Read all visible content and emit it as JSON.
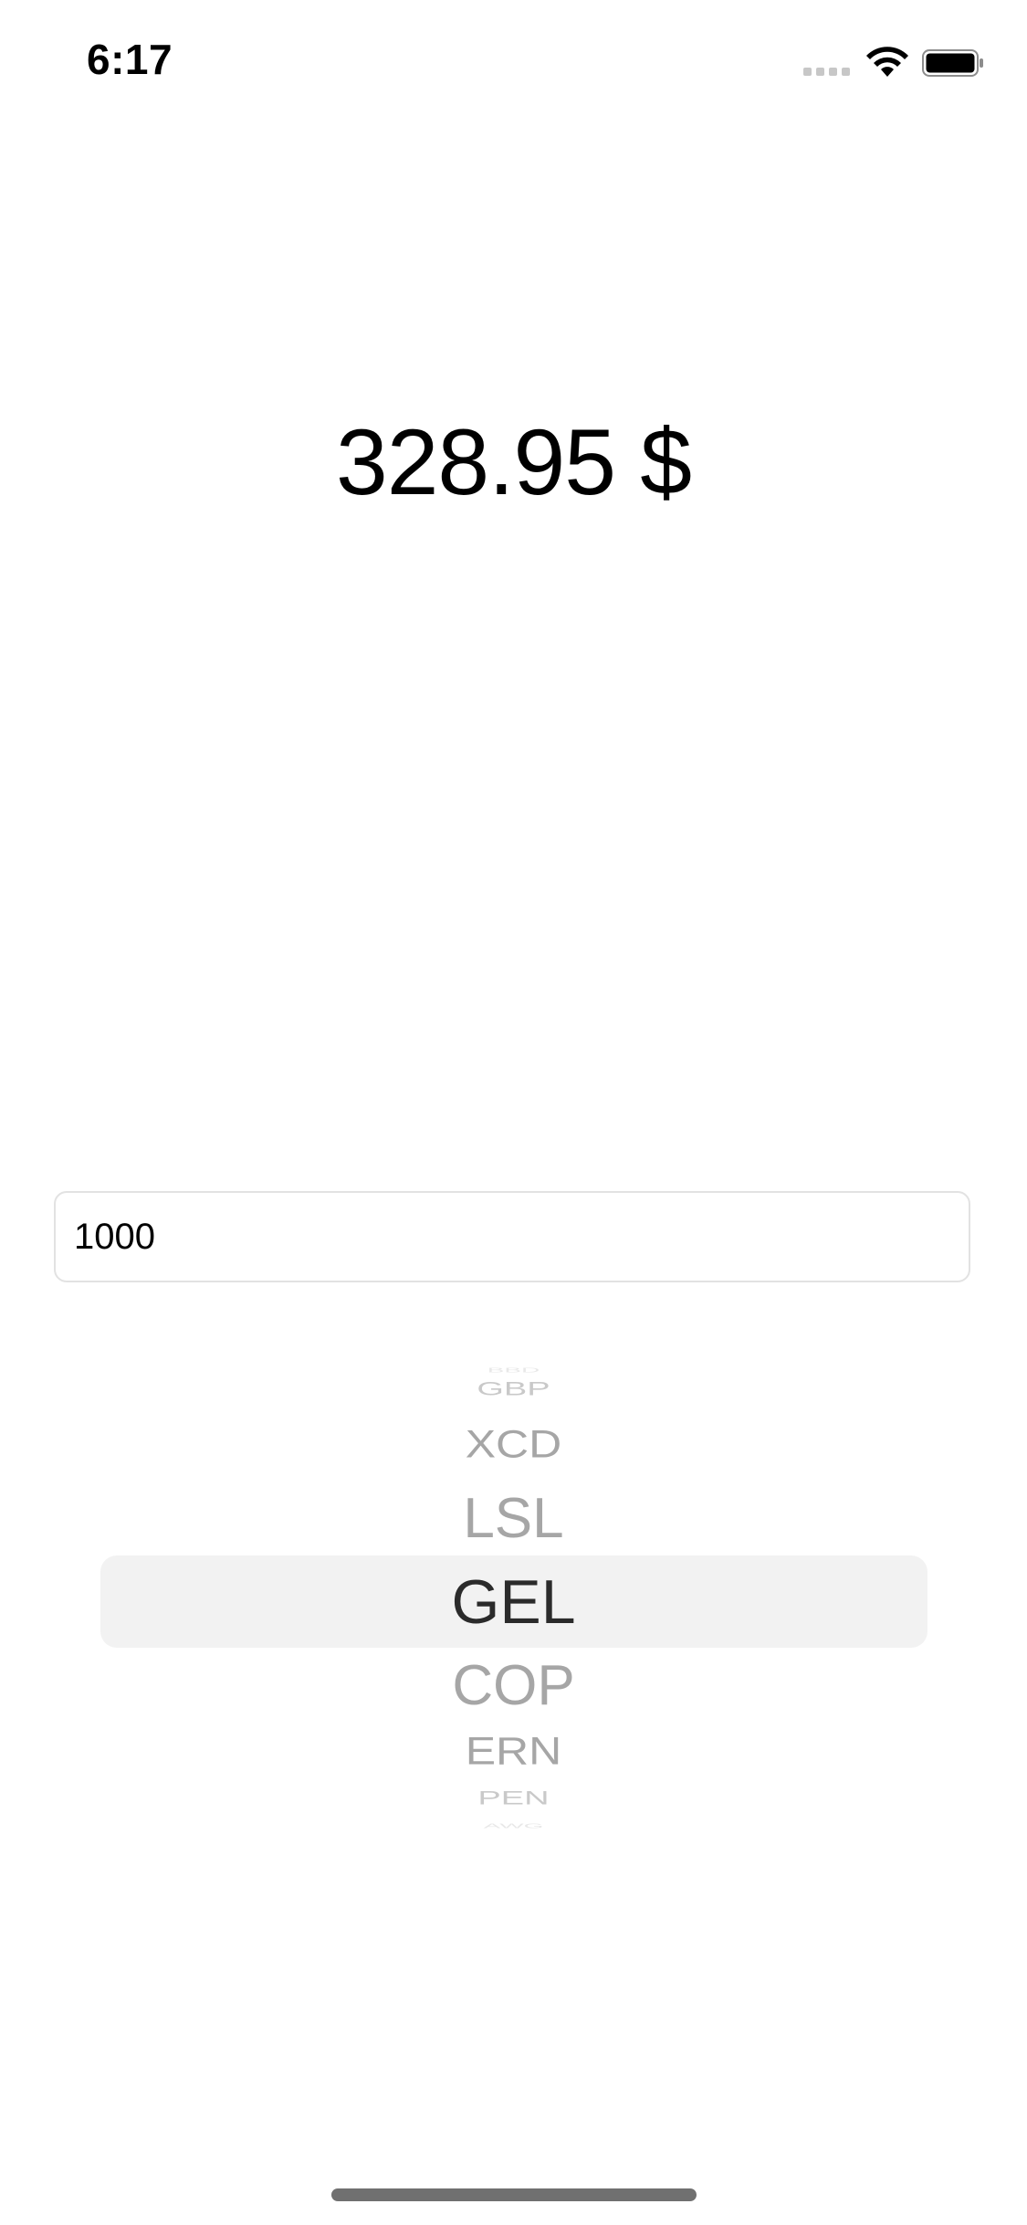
{
  "status_bar": {
    "time": "6:17",
    "icons": [
      "cellular-icon",
      "wifi-icon",
      "battery-icon"
    ]
  },
  "result": {
    "value": "328.95 $"
  },
  "amount_input": {
    "value": "1000"
  },
  "currency_picker": {
    "selected": "GEL",
    "items": [
      "BBD",
      "GBP",
      "XCD",
      "LSL",
      "GEL",
      "COP",
      "ERN",
      "PEN",
      "AWG"
    ]
  },
  "colors": {
    "selected_text": "#2b2b2b",
    "unselected_text": "#a6a6a6",
    "highlight_bg": "#f2f2f2",
    "field_border": "#e2e2e2"
  }
}
